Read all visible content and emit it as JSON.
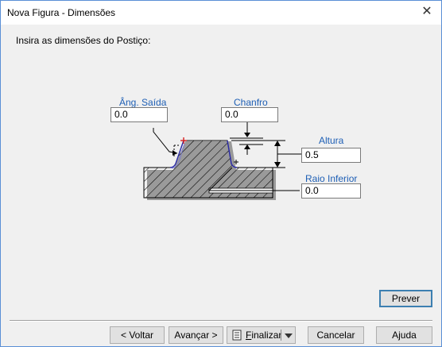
{
  "window": {
    "title": "Nova Figura - Dimensões",
    "close_glyph": "✕"
  },
  "instruction": "Insira as dimensões do Postiço:",
  "fields": {
    "ang_saida": {
      "label": "Âng. Saída",
      "value": "0.0"
    },
    "chanfro": {
      "label": "Chanfro",
      "value": "0.0"
    },
    "altura": {
      "label": "Altura",
      "value": "0.5"
    },
    "raio_inferior": {
      "label": "Raio Inferior",
      "value": "0.0"
    }
  },
  "buttons": {
    "prever": "Prever",
    "voltar": "< Voltar",
    "avancar": "Avançar >",
    "finalizar": "inalizar",
    "finalizar_mnemonic": "F",
    "cancelar": "Cancelar",
    "ajuda": "Ajuda"
  },
  "colors": {
    "label_blue": "#1e5fb5",
    "profile_blue": "#2a2aa8",
    "marker_red": "#d62020",
    "default_button_border": "#3c7fb1"
  },
  "icons": [
    "close-icon",
    "document-icon",
    "dropdown-arrow-icon"
  ]
}
